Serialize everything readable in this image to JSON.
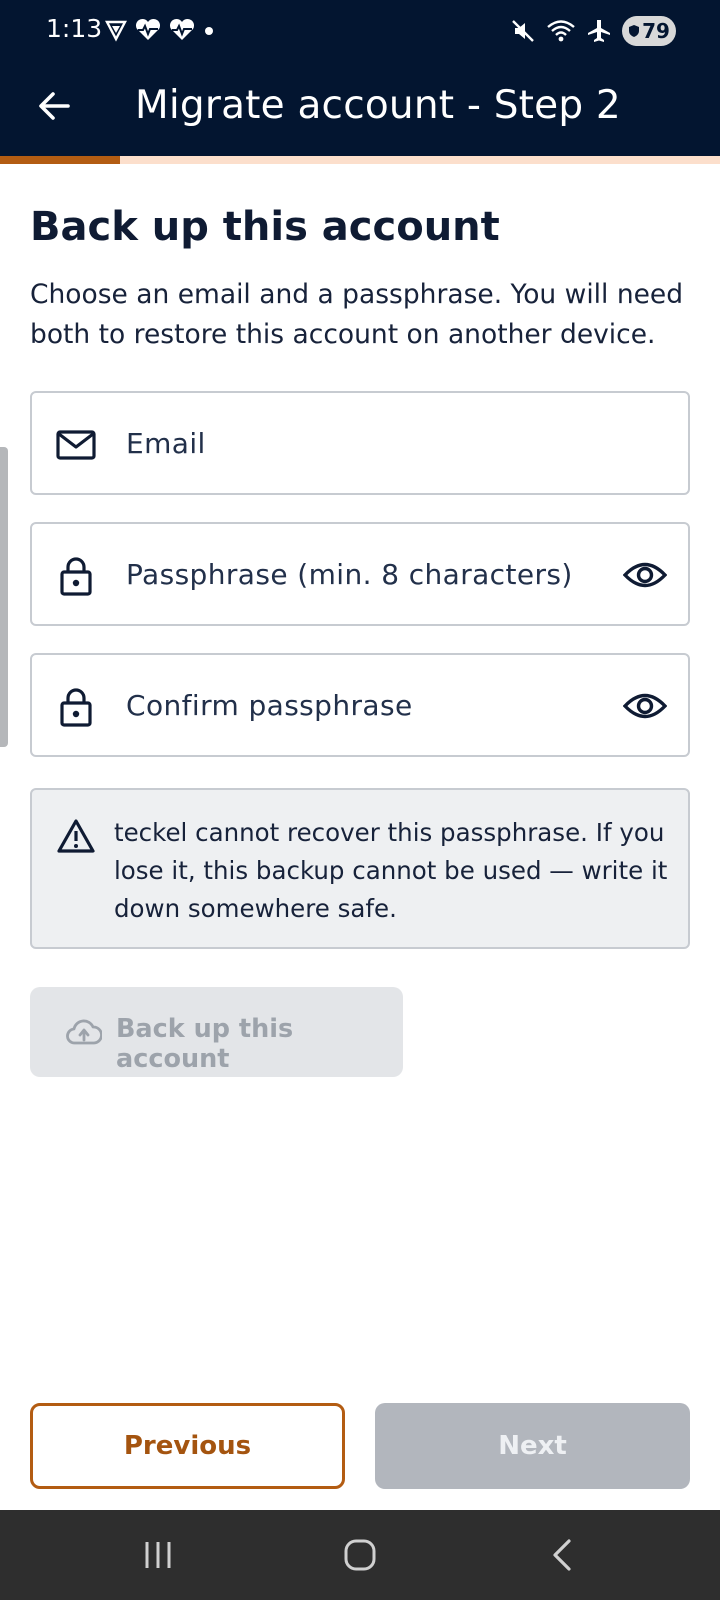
{
  "status_bar": {
    "time": "1:13",
    "battery": "79",
    "left_icons": [
      "vpn-shield-icon",
      "health-icon",
      "health-icon",
      "dot-icon"
    ],
    "right_icons": [
      "mute-icon",
      "wifi-icon",
      "airplane-icon",
      "battery-icon"
    ]
  },
  "app_bar": {
    "title": "Migrate account - Step 2",
    "back_icon": "arrow-left-icon"
  },
  "progress": {
    "fraction": 0.166,
    "fill_color": "#b35c12",
    "track_color": "#fcdfcc"
  },
  "content": {
    "title": "Back up this account",
    "description": "Choose an email and a passphrase. You will need both to restore this account on another device.",
    "fields": {
      "email": {
        "placeholder": "Email",
        "value": "",
        "icon": "mail-icon"
      },
      "passphrase": {
        "placeholder": "Passphrase (min. 8 characters)",
        "value": "",
        "icon": "lock-icon",
        "toggle_icon": "eye-icon"
      },
      "confirm": {
        "placeholder": "Confirm passphrase",
        "value": "",
        "icon": "lock-icon",
        "toggle_icon": "eye-icon"
      }
    },
    "warning": {
      "icon": "warning-icon",
      "text": "teckel cannot recover this passphrase. If you lose it, this backup cannot be used — write it down somewhere safe."
    },
    "backup_button": {
      "label": "Back up this account",
      "icon": "cloud-upload-icon",
      "enabled": false
    }
  },
  "footer": {
    "previous_label": "Previous",
    "next_label": "Next",
    "next_enabled": false
  },
  "colors": {
    "header_bg": "#031530",
    "accent": "#b35c12",
    "text_primary": "#0f1b33"
  }
}
